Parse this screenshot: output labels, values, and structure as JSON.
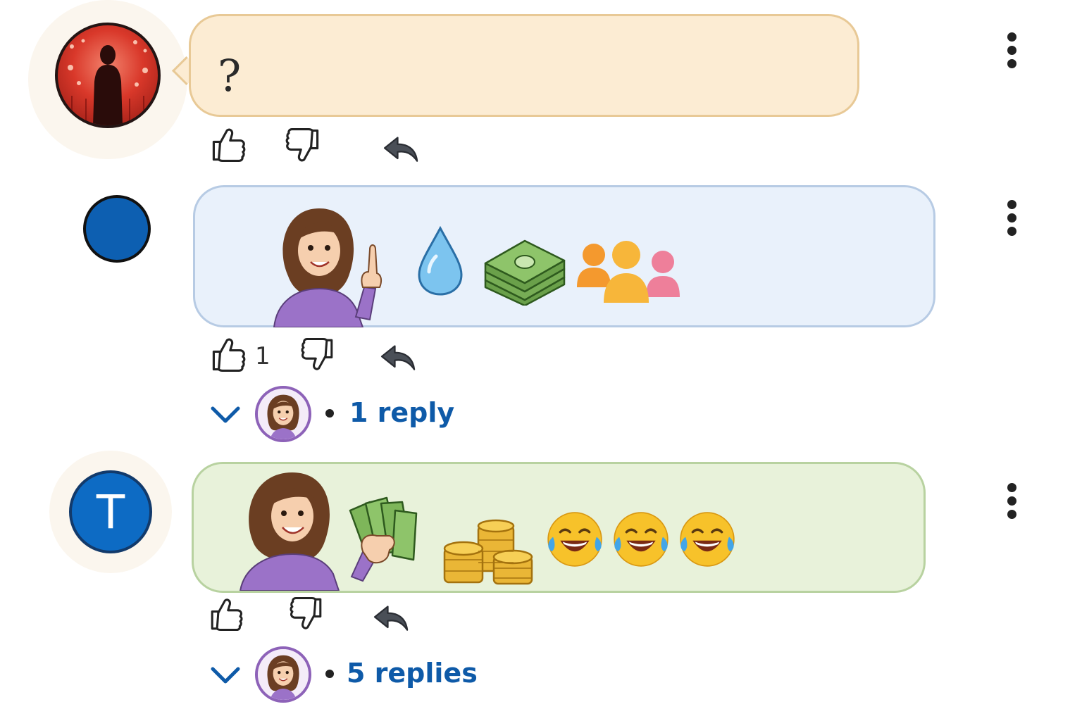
{
  "comments": [
    {
      "avatar_icon": "silhouette-concert-avatar",
      "text": "?",
      "likes": "",
      "bubble_color": "#fcecd3"
    },
    {
      "avatar_icon": "blue-circle-avatar",
      "emojis": [
        "woman-pointing-up",
        "droplet",
        "money-stack",
        "people-group"
      ],
      "likes": "1",
      "replies": {
        "label": "1 reply"
      },
      "bubble_color": "#e9f1fb"
    },
    {
      "avatar_letter": "T",
      "emojis": [
        "woman-holding-cash",
        "coin-stacks",
        "face-with-tears-of-joy",
        "face-with-tears-of-joy",
        "face-with-tears-of-joy"
      ],
      "likes": "",
      "replies": {
        "label": "5 replies"
      },
      "bubble_color": "#e8f2da"
    }
  ],
  "colors": {
    "link": "#0e5aa8",
    "avatar_blue": "#0d6bc4"
  }
}
